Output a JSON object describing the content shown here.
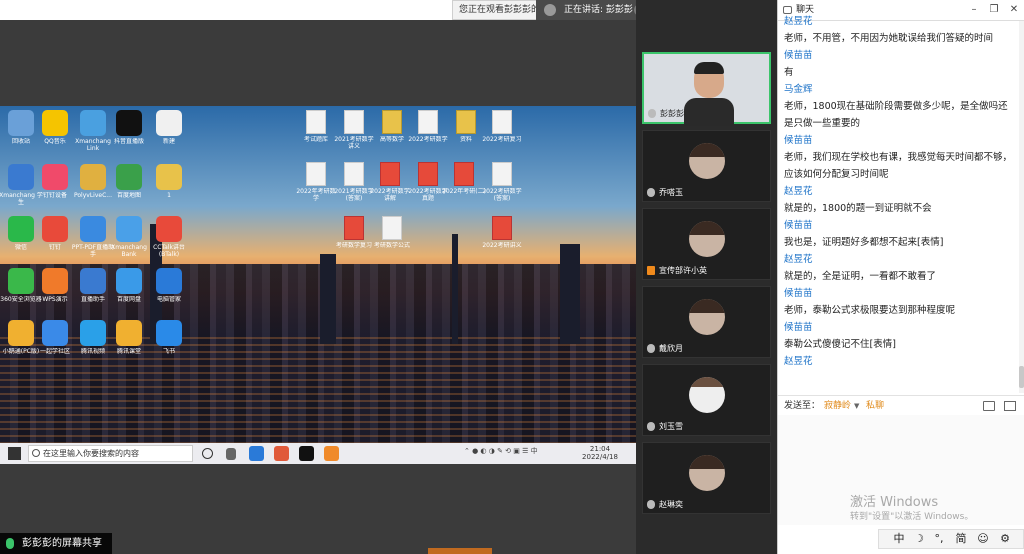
{
  "topbar": {
    "viewing_text": "您正在观看彭彭彭的屏",
    "speaking_text": "正在讲话: 彭彭彭"
  },
  "desktop": {
    "icons": [
      {
        "label": "回收站",
        "color": "#6aa0d8"
      },
      {
        "label": "QQ音乐",
        "color": "#f5c400"
      },
      {
        "label": "Xmanchang Link",
        "color": "#4aa0e0"
      },
      {
        "label": "抖音直播版",
        "color": "#111111"
      },
      {
        "label": "新建",
        "color": "#f0f0f0"
      },
      {
        "label": "Xmanchang 学生",
        "color": "#3a7ad0"
      },
      {
        "label": "钉钉设备",
        "color": "#f04a6a"
      },
      {
        "label": "PolyvLiveC...",
        "color": "#e0b040"
      },
      {
        "label": "百度地图",
        "color": "#3aa04a"
      },
      {
        "label": "1",
        "color": "#e8c24a"
      },
      {
        "label": "微信",
        "color": "#2ab84a"
      },
      {
        "label": "钉钉",
        "color": "#e84a3a"
      },
      {
        "label": "PPT-PDF直播助手",
        "color": "#3a8ae0"
      },
      {
        "label": "Xmanchang Bank",
        "color": "#4aa0e8"
      },
      {
        "label": "CCTalk讲台 (BTalk)",
        "color": "#e84a3a"
      },
      {
        "label": "360安全浏览器",
        "color": "#3ab84a"
      },
      {
        "label": "WPS演示",
        "color": "#f07a2a"
      },
      {
        "label": "直播助手",
        "color": "#3a7ad0"
      },
      {
        "label": "百度网盘",
        "color": "#3a9ae8"
      },
      {
        "label": "电脑管家",
        "color": "#2a7ad8"
      },
      {
        "label": "小鹅通(PC版)",
        "color": "#f0b030"
      },
      {
        "label": "一起学社区",
        "color": "#3a8ae8"
      },
      {
        "label": "腾讯视频",
        "color": "#2aa0e8"
      },
      {
        "label": "腾讯课堂",
        "color": "#f0b030"
      },
      {
        "label": "飞书",
        "color": "#2a8ae8"
      }
    ],
    "docs": [
      {
        "label": "考试题库"
      },
      {
        "label": "2021考研数学讲义"
      },
      {
        "label": "高等数学"
      },
      {
        "label": "2022考研数学"
      },
      {
        "label": "资料"
      },
      {
        "label": "2022年考研数学"
      },
      {
        "label": "2021考研数学(答案)"
      },
      {
        "label": "2022考研数学讲解"
      },
      {
        "label": "2022考研数学真题"
      },
      {
        "label": "2022年考研(二)"
      },
      {
        "label": "2022考研数学(答案)"
      },
      {
        "label": "考研数学复习"
      },
      {
        "label": "考研数学公式"
      },
      {
        "label": "2022考研讲义"
      },
      {
        "label": "2022考研复习"
      }
    ],
    "taskbar_search": "在这里输入你要搜索的内容",
    "clock_time": "21:04",
    "clock_date": "2022/4/18"
  },
  "share_label": "彭彭彭的屏幕共享",
  "participants": [
    {
      "name": "彭彭彭"
    },
    {
      "name": "乔嗒玉"
    },
    {
      "name": "宣传部许小英"
    },
    {
      "name": "戴欣月"
    },
    {
      "name": "刘玉雪"
    },
    {
      "name": "赵琳奕"
    }
  ],
  "chat": {
    "title": "聊天",
    "messages": [
      {
        "sender": "赵昱花",
        "text": ""
      },
      {
        "sender": "",
        "text": "老师，不用管，不用因为她耽误给我们答疑的时间"
      },
      {
        "sender": "候苗苗",
        "text": "有"
      },
      {
        "sender": "马金辉",
        "text": "老师，1800现在基础阶段需要做多少呢，是全做吗还是只做一些重要的"
      },
      {
        "sender": "候苗苗",
        "text": "老师，我们现在学校也有课，我感觉每天时间都不够，应该如何分配复习时间呢"
      },
      {
        "sender": "赵昱花",
        "text": "就是的，1800的题一到证明就不会"
      },
      {
        "sender": "候苗苗",
        "text": "我也是，证明题好多都想不起来[表情]"
      },
      {
        "sender": "赵昱花",
        "text": "就是的，全是证明，一看都不敢看了"
      },
      {
        "sender": "候苗苗",
        "text": "老师，泰勒公式求极限要达到那种程度呢"
      },
      {
        "sender": "候苗苗",
        "text": "泰勒公式傻傻记不住[表情]"
      },
      {
        "sender": "赵昱花",
        "text": ""
      }
    ],
    "send_to_label": "发送至：",
    "send_target": "寂静岭",
    "private_label": "私聊"
  },
  "watermark": {
    "line1": "激活 Windows",
    "line2": "转到\"设置\"以激活 Windows。"
  },
  "ime": {
    "lang": "中",
    "moon": "☽",
    "punct": "°,",
    "simp": "简",
    "emoji": "☺",
    "gear": "⚙"
  }
}
